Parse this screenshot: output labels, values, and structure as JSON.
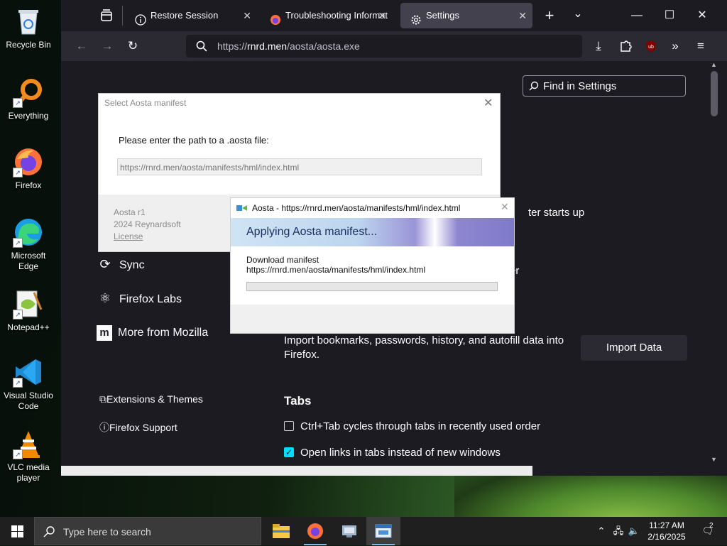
{
  "desktop": {
    "icons": [
      {
        "label": "Recycle Bin",
        "icon": "recycle-bin-icon"
      },
      {
        "label": "Everything",
        "icon": "everything-icon"
      },
      {
        "label": "Firefox",
        "icon": "firefox-icon"
      },
      {
        "label": "Microsoft Edge",
        "icon": "edge-icon"
      },
      {
        "label": "Notepad++",
        "icon": "notepadpp-icon"
      },
      {
        "label": "Visual Studio Code",
        "icon": "vscode-icon"
      },
      {
        "label": "VLC media player",
        "icon": "vlc-icon"
      }
    ]
  },
  "browser": {
    "tabs": [
      {
        "label": "Restore Session",
        "icon": "info-icon"
      },
      {
        "label": "Troubleshooting Informat",
        "icon": "firefox-icon"
      },
      {
        "label": "Settings",
        "icon": "gear-icon"
      }
    ],
    "new_tab": "+",
    "tab_list": "⌄",
    "url": {
      "scheme": "https://",
      "host": "rnrd.men",
      "path": "/aosta/aosta.exe"
    },
    "colors": {
      "toolbar": "#2b2a33",
      "accent": "#00ddff"
    }
  },
  "settings": {
    "find_placeholder": "Find in Settings",
    "categories": [
      {
        "label": "Sync",
        "icon": "sync-icon"
      },
      {
        "label": "Firefox Labs",
        "icon": "labs-icon"
      },
      {
        "label": "More from Mozilla",
        "icon": "mozilla-icon"
      }
    ],
    "footer_links": [
      {
        "label": "Extensions & Themes",
        "icon": "puzzle-icon"
      },
      {
        "label": "Firefox Support",
        "icon": "help-icon"
      }
    ],
    "partial_text_1": "ter starts up",
    "partial_text_2": "er",
    "import_text": "Import bookmarks, passwords, history, and autofill data into Firefox.",
    "import_button": "Import Data",
    "tabs_heading": "Tabs",
    "options": [
      {
        "label": "Ctrl+Tab cycles through tabs in recently used order",
        "checked": false
      },
      {
        "label": "Open links in tabs instead of new windows",
        "checked": true
      }
    ]
  },
  "select_dialog": {
    "title": "Select Aosta manifest",
    "prompt": "Please enter the path to a .aosta file:",
    "path_value": "https://rnrd.men/aosta/manifests/hml/index.html",
    "footer_name": "Aosta r1",
    "footer_copyright": "2024 Reynardsoft",
    "footer_license": "License"
  },
  "progress_dialog": {
    "title": "Aosta - https://rnrd.men/aosta/manifests/hml/index.html",
    "heading": "Applying Aosta manifest...",
    "step": "Download manifest",
    "step_url": "https://rnrd.men/aosta/manifests/hml/index.html",
    "progress": 0
  },
  "taskbar": {
    "search_placeholder": "Type here to search",
    "time": "11:27 AM",
    "date": "2/16/2025",
    "notification_count": "2"
  }
}
